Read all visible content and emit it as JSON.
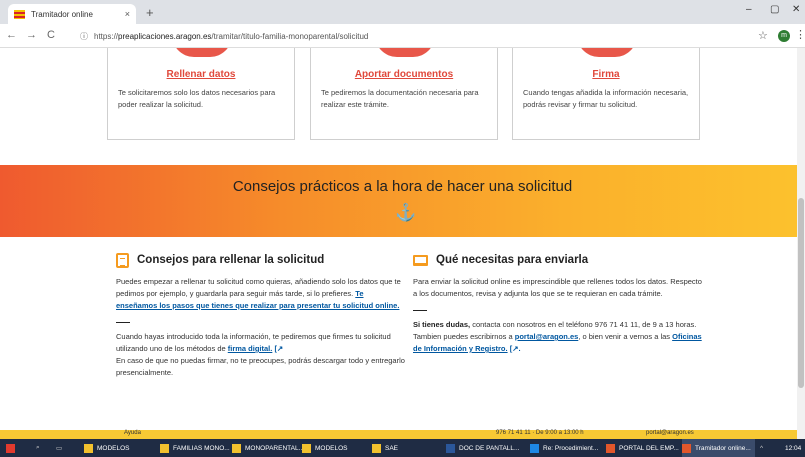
{
  "browser": {
    "tab_title": "Tramitador online",
    "tab_close": "×",
    "new_tab": "+",
    "minimize": "–",
    "maximize": "▢",
    "close": "✕",
    "back": "←",
    "forward": "→",
    "reload": "C",
    "url_prefix": "https://",
    "url_host": "preaplicaciones.aragon.es",
    "url_path": "/tramitar/titulo-familia-monoparental/solicitud",
    "bookmark": "☆",
    "profile_initial": "m",
    "menu": "⋮"
  },
  "steps": [
    {
      "title": "Rellenar datos",
      "desc": "Te solicitaremos solo los datos necesarios para poder realizar la solicitud."
    },
    {
      "title": "Aportar documentos",
      "desc": "Te pediremos la documentación necesaria para realizar este trámite."
    },
    {
      "title": "Firma",
      "desc": "Cuando tengas añadida la información necesaria, podrás revisar y firmar tu solicitud."
    }
  ],
  "banner": {
    "title": "Consejos prácticos a la hora de hacer una solicitud",
    "anchor_glyph": "⚓"
  },
  "left": {
    "heading": "Consejos para rellenar la solicitud",
    "p1": "Puedes empezar a rellenar tu solicitud como quieras, añadiendo solo los datos que te pedimos por ejemplo, y guardarla para seguir más tarde, si lo prefieres. ",
    "p1_link": "Te enseñamos los pasos que tienes que realizar para presentar tu solicitud online.",
    "p2": "Cuando hayas introducido toda la información, te pediremos que firmes tu solicitud utilizando uno de los métodos de ",
    "p2_link": "firma digital.",
    "p3": "En caso de que no puedas firmar, no te preocupes, podrás descargar todo y entregarlo presencialmente."
  },
  "right": {
    "heading": "Qué necesitas para enviarla",
    "p1": "Para enviar la solicitud online es imprescindible que rellenes todos los datos. Respecto a los documentos, revisa y adjunta los que se te requieran en cada trámite.",
    "p2_bold": "Si tienes dudas,",
    "p2": " contacta con nosotros en el teléfono 976 71 41 11, de 9 a 13 horas. Tambien puedes escribirnos a ",
    "p2_link": "portal@aragon.es",
    "p2b": ", o bien venir a vernos a las ",
    "p2_link2": "Oficinas de Información y Registro."
  },
  "footer": {
    "help": "Ayuda",
    "phone": "976 71 41 11 · De 9:00 a 13:00 h",
    "email": "portal@aragon.es"
  },
  "taskbar": {
    "items": [
      {
        "label": "MODELOS",
        "color": "#f2c12e"
      },
      {
        "label": "FAMILIAS MONO...",
        "color": "#f2c12e"
      },
      {
        "label": "MONOPARENTAL...",
        "color": "#f2c12e"
      },
      {
        "label": "MODELOS",
        "color": "#f2c12e"
      },
      {
        "label": "SAE",
        "color": "#f2c12e"
      },
      {
        "label": "DOC DE PANTALL...",
        "color": "#2b579a"
      },
      {
        "label": "Re: Procedimient...",
        "color": "#1e88e5"
      },
      {
        "label": "PORTAL DEL EMP...",
        "color": "#e2572b"
      },
      {
        "label": "Tramitador online...",
        "color": "#e2572b"
      }
    ],
    "time": "12:04"
  }
}
